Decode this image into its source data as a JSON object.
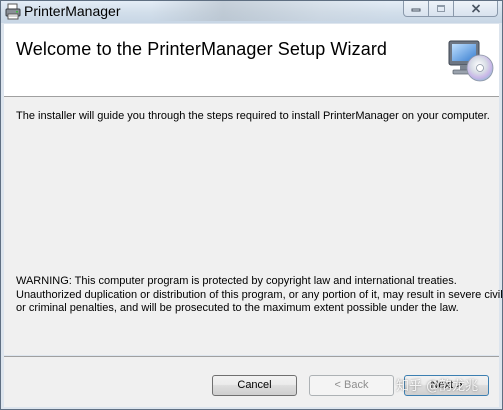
{
  "window": {
    "title": "PrinterManager"
  },
  "header": {
    "title": "Welcome to the PrinterManager Setup Wizard",
    "icon": "computer-with-disc-icon"
  },
  "body": {
    "intro": "The installer will guide you through the steps required to install PrinterManager on your computer.",
    "warning_lines": [
      "WARNING: This computer program is protected by copyright law and international treaties.",
      "Unauthorized duplication or distribution of this program, or any portion of it, may result in severe civil",
      "or criminal penalties, and will be prosecuted to the maximum extent possible under the law."
    ]
  },
  "footer": {
    "cancel_label": "Cancel",
    "back_label": "< Back",
    "next_label": "Next >",
    "watermark": "知乎 @韵龙兆"
  },
  "colors": {
    "titlebar": "#d3dfeb",
    "header_bg": "#ffffff",
    "body_bg": "#f0f0f0",
    "disabled_text": "#8d8d8d"
  }
}
